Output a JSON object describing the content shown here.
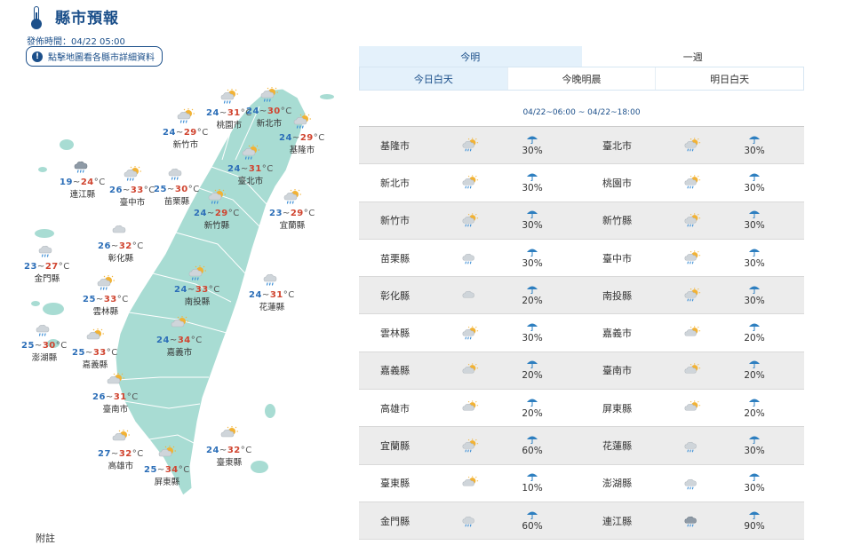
{
  "header": {
    "title": "縣市預報",
    "issue_time": "發佈時間：04/22 05:00",
    "map_button": "點擊地圖看各縣市詳細資料"
  },
  "colors": {
    "accent": "#1b4f8a",
    "map_fill": "#a8dcd3",
    "low_temp": "#2d6fb8",
    "high_temp": "#d0442f"
  },
  "map": {
    "unit": "°C",
    "cities": [
      {
        "id": "taoyuan",
        "name": "桃園市",
        "lo": "24",
        "hi": "31",
        "icon": "sun-cloud-rain"
      },
      {
        "id": "newtaipei",
        "name": "新北市",
        "lo": "24",
        "hi": "30",
        "icon": "sun-cloud-rain"
      },
      {
        "id": "keelung",
        "name": "基隆市",
        "lo": "24",
        "hi": "29",
        "icon": "sun-cloud-rain"
      },
      {
        "id": "hsinchucity",
        "name": "新竹市",
        "lo": "24",
        "hi": "29",
        "icon": "sun-cloud-rain"
      },
      {
        "id": "taipei",
        "name": "臺北市",
        "lo": "24",
        "hi": "31",
        "icon": "sun-cloud-rain"
      },
      {
        "id": "lienchiang",
        "name": "連江縣",
        "lo": "19",
        "hi": "24",
        "icon": "cloud-rain-dark"
      },
      {
        "id": "taichung",
        "name": "臺中市",
        "lo": "26",
        "hi": "33",
        "icon": "sun-cloud-rain"
      },
      {
        "id": "miaoli",
        "name": "苗栗縣",
        "lo": "25",
        "hi": "30",
        "icon": "cloud-rain"
      },
      {
        "id": "hsinchucounty",
        "name": "新竹縣",
        "lo": "24",
        "hi": "29",
        "icon": "sun-cloud-rain"
      },
      {
        "id": "yilan",
        "name": "宜蘭縣",
        "lo": "23",
        "hi": "29",
        "icon": "sun-cloud-rain"
      },
      {
        "id": "changhua",
        "name": "彰化縣",
        "lo": "26",
        "hi": "32",
        "icon": "cloud"
      },
      {
        "id": "kinmen",
        "name": "金門縣",
        "lo": "23",
        "hi": "27",
        "icon": "cloud-rain"
      },
      {
        "id": "nantou",
        "name": "南投縣",
        "lo": "24",
        "hi": "33",
        "icon": "sun-cloud-rain"
      },
      {
        "id": "hualien",
        "name": "花蓮縣",
        "lo": "24",
        "hi": "31",
        "icon": "cloud-rain"
      },
      {
        "id": "yunlin",
        "name": "雲林縣",
        "lo": "25",
        "hi": "33",
        "icon": "sun-cloud-rain"
      },
      {
        "id": "penghu",
        "name": "澎湖縣",
        "lo": "25",
        "hi": "30",
        "icon": "cloud-rain"
      },
      {
        "id": "chiayicounty",
        "name": "嘉義縣",
        "lo": "25",
        "hi": "33",
        "icon": "sun-cloud"
      },
      {
        "id": "chiayicity",
        "name": "嘉義市",
        "lo": "24",
        "hi": "34",
        "icon": "sun-cloud"
      },
      {
        "id": "tainan",
        "name": "臺南市",
        "lo": "26",
        "hi": "31",
        "icon": "sun-cloud"
      },
      {
        "id": "kaohsiung",
        "name": "高雄市",
        "lo": "27",
        "hi": "32",
        "icon": "sun-cloud"
      },
      {
        "id": "taitung",
        "name": "臺東縣",
        "lo": "24",
        "hi": "32",
        "icon": "sun-cloud"
      },
      {
        "id": "pingtung",
        "name": "屏東縣",
        "lo": "25",
        "hi": "34",
        "icon": "sun-cloud"
      }
    ]
  },
  "tabs": {
    "main": [
      "今明",
      "一週"
    ],
    "sub": [
      "今日白天",
      "今晚明晨",
      "明日白天"
    ]
  },
  "period": "04/22~06:00 ~ 04/22~18:00",
  "table": [
    {
      "left": {
        "name": "基隆市",
        "icon": "sun-cloud-rain",
        "rain": "30%"
      },
      "right": {
        "name": "臺北市",
        "icon": "sun-cloud-rain",
        "rain": "30%"
      }
    },
    {
      "left": {
        "name": "新北市",
        "icon": "sun-cloud-rain",
        "rain": "30%"
      },
      "right": {
        "name": "桃園市",
        "icon": "sun-cloud-rain",
        "rain": "30%"
      }
    },
    {
      "left": {
        "name": "新竹市",
        "icon": "sun-cloud-rain",
        "rain": "30%"
      },
      "right": {
        "name": "新竹縣",
        "icon": "sun-cloud-rain",
        "rain": "30%"
      }
    },
    {
      "left": {
        "name": "苗栗縣",
        "icon": "cloud-rain",
        "rain": "30%"
      },
      "right": {
        "name": "臺中市",
        "icon": "sun-cloud-rain",
        "rain": "30%"
      }
    },
    {
      "left": {
        "name": "彰化縣",
        "icon": "cloud",
        "rain": "20%"
      },
      "right": {
        "name": "南投縣",
        "icon": "sun-cloud-rain",
        "rain": "30%"
      }
    },
    {
      "left": {
        "name": "雲林縣",
        "icon": "sun-cloud-rain",
        "rain": "30%"
      },
      "right": {
        "name": "嘉義市",
        "icon": "sun-cloud",
        "rain": "20%"
      }
    },
    {
      "left": {
        "name": "嘉義縣",
        "icon": "sun-cloud",
        "rain": "20%"
      },
      "right": {
        "name": "臺南市",
        "icon": "sun-cloud",
        "rain": "20%"
      }
    },
    {
      "left": {
        "name": "高雄市",
        "icon": "sun-cloud",
        "rain": "20%"
      },
      "right": {
        "name": "屏東縣",
        "icon": "sun-cloud",
        "rain": "20%"
      }
    },
    {
      "left": {
        "name": "宜蘭縣",
        "icon": "sun-cloud-rain",
        "rain": "60%"
      },
      "right": {
        "name": "花蓮縣",
        "icon": "cloud-rain",
        "rain": "30%"
      }
    },
    {
      "left": {
        "name": "臺東縣",
        "icon": "sun-cloud",
        "rain": "10%"
      },
      "right": {
        "name": "澎湖縣",
        "icon": "cloud-rain",
        "rain": "30%"
      }
    },
    {
      "left": {
        "name": "金門縣",
        "icon": "cloud-rain",
        "rain": "60%"
      },
      "right": {
        "name": "連江縣",
        "icon": "cloud-rain-dark",
        "rain": "90%"
      }
    }
  ],
  "footer": {
    "note": "附註"
  }
}
